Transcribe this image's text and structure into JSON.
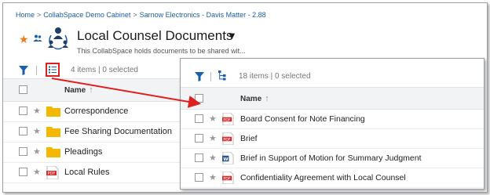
{
  "breadcrumb": [
    "Home",
    "CollabSpace Demo Cabinet",
    "Sarnow Electronics - Davis Matter - 2.88"
  ],
  "header": {
    "title": "Local Counsel Documents",
    "subtitle": "This CollabSpace holds documents to be shared wit..."
  },
  "left_panel": {
    "count_text": "4 items | 0 selected",
    "column_name": "Name",
    "items": [
      {
        "label": "Correspondence",
        "type": "folder"
      },
      {
        "label": "Fee Sharing Documentation",
        "type": "folder"
      },
      {
        "label": "Pleadings",
        "type": "folder"
      },
      {
        "label": "Local Rules",
        "type": "pdf"
      }
    ]
  },
  "right_panel": {
    "count_text": "18 items | 0 selected",
    "column_name": "Name",
    "items": [
      {
        "label": "Board Consent for Note Financing",
        "type": "pdf"
      },
      {
        "label": "Brief",
        "type": "pdf"
      },
      {
        "label": "Brief in Support of Motion for Summary Judgment",
        "type": "word"
      },
      {
        "label": "Confidentiality Agreement with Local Counsel",
        "type": "pdf"
      }
    ]
  },
  "icons": {
    "favorite": "star-icon",
    "filter": "filter-icon",
    "list_view": "list-view-icon",
    "tree_view": "tree-view-icon",
    "collab": "collabspace-icon",
    "folder": "folder-icon",
    "pdf": "pdf-file-icon",
    "word": "word-file-icon"
  },
  "colors": {
    "accent_blue": "#1a5fa8",
    "folder_yellow": "#f5b800",
    "pdf_red": "#d32f2f",
    "highlight_red": "#e02020",
    "favorite_orange": "#f07d1a"
  }
}
